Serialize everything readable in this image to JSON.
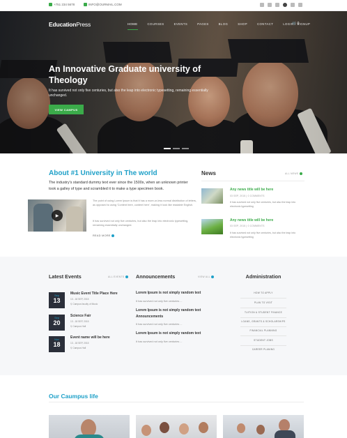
{
  "topbar": {
    "phone": "+751 234 5678",
    "email": "INFO@OURMAIL.COM",
    "social_icons": [
      "twitter-icon",
      "facebook-icon",
      "linkedin-icon",
      "pinterest-icon",
      "instagram-icon",
      "youtube-icon"
    ]
  },
  "brand": {
    "name_bold": "Education",
    "name_light": "Press"
  },
  "nav": {
    "items": [
      "HOME",
      "COURSES",
      "EVENTS",
      "PAGES",
      "BLOG",
      "SHOP",
      "CONTACT",
      "LOGIN / SIGNUP"
    ],
    "active_index": 0,
    "cart_count": "0"
  },
  "hero": {
    "title": "An Innovative Graduate university of Theology",
    "subtitle": "It has survived not only five centuries, but also the leap into electronic typesetting, remaining essentially unchanged.",
    "button": "VIEW CAMPUS",
    "slide_count": 3,
    "active_slide": 0
  },
  "about": {
    "title": "About #1 University in The world",
    "intro": "The industry's standard dummy text ever since the 1500s, when an unknown printer took a galley of type and scrambled it to make a type specimen book.",
    "p1": "The point of using Lorem Ipsum is that it has a more-or-less normal distribution of letters, as opposed to using 'Content here, content here', making it look like readable English.",
    "p2": "It has survived not only five centuries, but also the leap into electronic typesetting, remaining essentially unchanged.",
    "read_more": "READ MORE"
  },
  "news": {
    "title": "News",
    "all_link": "ALL NEWS",
    "items": [
      {
        "title": "Any news title will be here",
        "meta": "03 SEP, 2015   |   0 COMMENTS",
        "excerpt": "It has survived not only five centuries, but also the leap into electronic typesetting"
      },
      {
        "title": "Any news title will be here",
        "meta": "03 SEP, 2015   |   0 COMMENTS",
        "excerpt": "It has survived not only five centuries, but also the leap into electronic typesetting"
      }
    ]
  },
  "events": {
    "title": "Latest Events",
    "all_link": "ALL EVENTS",
    "items": [
      {
        "month": "Sep",
        "day": "13",
        "title": "Music Event Title Place Here",
        "date": "13 - 18 SEP, 2015",
        "place": "Campus faculty of Music"
      },
      {
        "month": "Sep",
        "day": "20",
        "title": "Science Fair",
        "date": "13 - 18 SEP, 2015",
        "place": "Campus Hall"
      },
      {
        "month": "Nov",
        "day": "18",
        "title": "Event name will be here",
        "date": "13 - 18 SEP, 2015",
        "place": "Campus Hall"
      }
    ]
  },
  "announcements": {
    "title": "Announcements",
    "all_link": "VIEW ALL",
    "items": [
      {
        "title": "Lorem Ipsum is not simply random text",
        "summary": "It has survived not only five centuries ..."
      },
      {
        "title": "Lorem Ipsum is not simply random text Announcements",
        "summary": "It has survived not only five centuries ..."
      },
      {
        "title": "Lorem Ipsum is not simply random text",
        "summary": "It has survived not only five centuries ..."
      }
    ]
  },
  "administration": {
    "title": "Administration",
    "links": [
      "HOW TO APPLY",
      "PLAN TO VISIT",
      "TUITION & STUDENT FINANCE",
      "LOANS, GRANTS & SCHOLARSHIPS",
      "FINANCIAL PLANNING",
      "STUDENT JOBS",
      "CAREER PLANING"
    ]
  },
  "campus": {
    "title": "Our Caumpus life"
  },
  "colors": {
    "accent_green": "#3bab4a",
    "accent_blue": "#1ea0c8",
    "dark": "#2b2f3a"
  }
}
